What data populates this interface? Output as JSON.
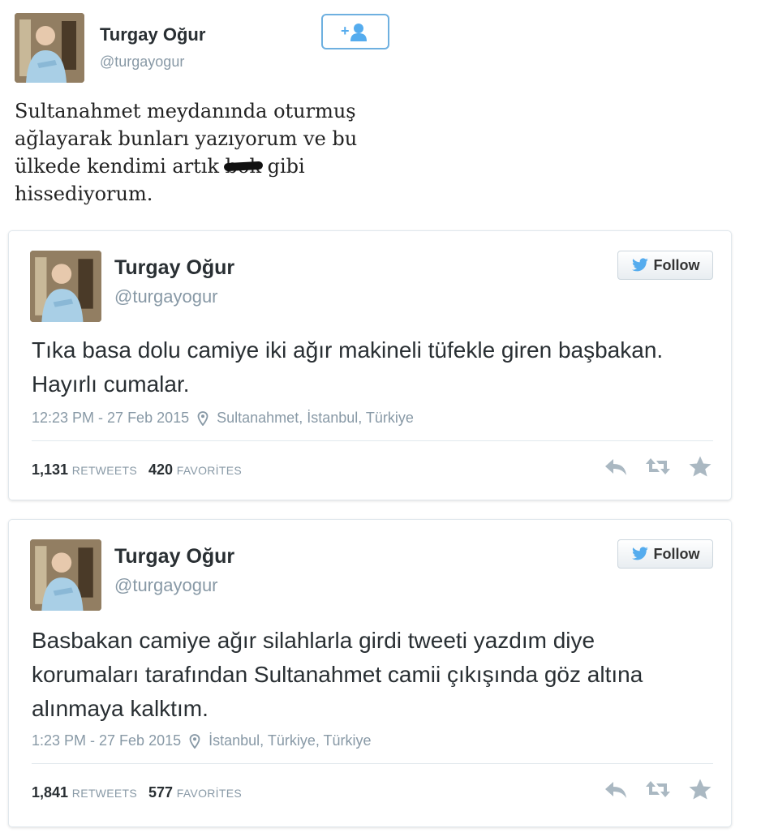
{
  "top_tweet": {
    "name": "Turgay Oğur",
    "handle": "@turgayogur",
    "follow_icon": "add-user-icon",
    "text_before": "Sultanahmet meydanında oturmuş ağlayarak bunları yazıyorum ve bu ülkede kendimi artık ",
    "text_censored": "bok",
    "text_after": " gibi hissediyorum."
  },
  "tweets": [
    {
      "name": "Turgay Oğur",
      "handle": "@turgayogur",
      "follow_label": "Follow",
      "text": "Tıka basa dolu camiye iki ağır makineli tüfekle giren başbakan. Hayırlı cumalar.",
      "timestamp": "12:23 PM - 27 Feb 2015",
      "location": "Sultanahmet, İstanbul, Türkiye",
      "retweets": "1,131",
      "retweets_label": "RETWEETS",
      "favorites": "420",
      "favorites_label": "FAVORİTES"
    },
    {
      "name": "Turgay Oğur",
      "handle": "@turgayogur",
      "follow_label": "Follow",
      "text": "Basbakan camiye ağır silahlarla girdi tweeti yazdım diye korumaları tarafından Sultanahmet camii çıkışında göz altına alınmaya kalktım.",
      "timestamp": "1:23 PM - 27 Feb 2015",
      "location": "İstanbul, Türkiye, Türkiye",
      "retweets": "1,841",
      "retweets_label": "RETWEETS",
      "favorites": "577",
      "favorites_label": "FAVORİTES"
    }
  ],
  "icons": {
    "twitter_bird": "twitter-bird-icon",
    "location": "location-pin-icon",
    "reply": "reply-icon",
    "retweet": "retweet-icon",
    "favorite": "star-icon"
  },
  "colors": {
    "twitter_blue": "#55acee",
    "text": "#292f33",
    "muted": "#8899a6",
    "border": "#e1e8ed"
  }
}
